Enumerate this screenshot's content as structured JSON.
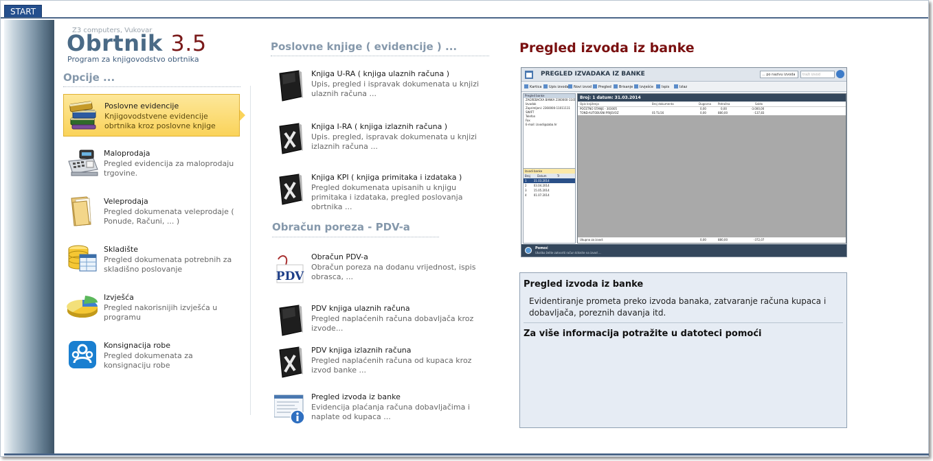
{
  "topbar": {
    "start_label": "START"
  },
  "brand": {
    "company": "Z3 computers, Vukovar",
    "name": "Obrtnik",
    "version": "3.5",
    "subtitle": "Program za knjigovodstvo obrtnika"
  },
  "options": {
    "title": "Opcije ...",
    "items": [
      {
        "title": "Poslovne evidencije",
        "desc": "Knjigovodstvene evidencije obrtnika kroz poslovne knjige",
        "icon": "books-icon",
        "active": true
      },
      {
        "title": "Maloprodaja",
        "desc": "Pregled evidencija za maloprodaju trgovine.",
        "icon": "cash-register-icon",
        "active": false
      },
      {
        "title": "Veleprodaja",
        "desc": "Pregled dokumenata veleprodaje ( Ponude, Računi, ... )",
        "icon": "folder-icon",
        "active": false
      },
      {
        "title": "Skladište",
        "desc": "Pregled dokumenata potrebnih za skladišno poslovanje",
        "icon": "database-table-icon",
        "active": false
      },
      {
        "title": "Izvješća",
        "desc": "Pregled nakorisnijih izvješća u programu",
        "icon": "pie-chart-icon",
        "active": false
      },
      {
        "title": "Konsignacija robe",
        "desc": "Pregled dokumenata za konsignaciju robe",
        "icon": "users-group-icon",
        "active": false
      }
    ]
  },
  "books": {
    "title": "Poslovne knjige ( evidencije ) ...",
    "items": [
      {
        "title": "Knjiga U-RA ( knjiga ulaznih računa )",
        "desc": "Upis, pregled i ispravak dokumenata u knjizi ulaznih računa ...",
        "icon": "black-book-icon"
      },
      {
        "title": "Knjiga I-RA ( knjiga izlaznih računa )",
        "desc": "Upis. pregled, ispravak dokumenata u knjizi izlaznih računa ...",
        "icon": "black-book-x-icon"
      },
      {
        "title": "Knjiga KPI ( knjiga primitaka i izdataka )",
        "desc": "Pregled dokumenata upisanih u knjigu primitaka i izdataka, pregled poslovanja obrtnika ...",
        "icon": "black-book-x-icon"
      }
    ]
  },
  "tax": {
    "title": "Obračun poreza - PDV-a",
    "items": [
      {
        "title": "Obračun PDV-a",
        "desc": "Obračun poreza na dodanu vrijednost, ispis obrasca, ...",
        "icon": "pdv-icon",
        "icon_text": "PDV"
      },
      {
        "title": "PDV knjiga ulaznih računa",
        "desc": "Pregled naplaćenih računa dobavljača kroz izvode...",
        "icon": "black-book-icon"
      },
      {
        "title": "PDV knjiga izlaznih računa",
        "desc": "Pregled naplaćenih računa od kupaca kroz izvod banke ...",
        "icon": "black-book-x-icon"
      },
      {
        "title": "Pregled izvoda iz banke",
        "desc": "Evidencija plaćanja računa dobavljačima i naplate od kupaca ...",
        "icon": "statement-info-icon"
      }
    ]
  },
  "detail": {
    "heading": "Pregled izvoda iz banke",
    "preview": {
      "title": "PREGLED IZVADAKA IZ BANKE",
      "combo": "... po nazivu izvoda",
      "search_placeholder": "traži izvod",
      "toolbar": [
        "Kartica",
        "Upis izvoda",
        "Novi izvod",
        "Pregled",
        "Brisanje",
        "Izvješće",
        "Ispis",
        "Izlaz"
      ],
      "tree_head": "Pregled banke",
      "tree": [
        "ZAGREBAČKA BANKA 2360000-1101...",
        "Izvadak",
        "Zaprimljeni: 2360000-11011111",
        "SWIFT",
        "Telefon",
        "Fax",
        "E-mail: izvodi@zaba.hr"
      ],
      "list_head": "Izvodi banke",
      "list_cols": [
        "Broj",
        "Datum",
        "Tr"
      ],
      "list_rows": [
        {
          "broj": "1",
          "datum": "31.03.2014",
          "selected": true
        },
        {
          "broj": "2",
          "datum": "03.04.2014",
          "selected": false
        },
        {
          "broj": "3",
          "datum": "15.05.2014",
          "selected": false
        },
        {
          "broj": "4",
          "datum": "01.07.2014",
          "selected": false
        }
      ],
      "main_title": "Broj: 1  datum: 31.03.2014",
      "grid_cols": [
        "Opis knjiženja",
        "Broj dokumenta",
        "Dugovna",
        "Potražna",
        "Saldo"
      ],
      "grid_rows": [
        {
          "opis": "POČETNO STANJE - 303005",
          "dok": "",
          "dug": "0,00",
          "pot": "0,00",
          "saldo": "-3.000,00"
        },
        {
          "opis": "TOND-AUTOBUSNI PRIJEVOZ",
          "dok": "01-TL/16",
          "dug": "0,00",
          "pot": "880,00",
          "saldo": "-137,83"
        }
      ],
      "total_label": "Ukupno za izvod:",
      "total_dug": "0,00",
      "total_pot": "880,00",
      "total_saldo": "-372,07",
      "footer_title": "Pomoć",
      "footer_text": "Ukoliko želite zatvoriti račun kliknite na izvod ..."
    },
    "info_title": "Pregled izvoda iz banke",
    "info_desc": "Evidentiranje prometa preko izvoda banaka, zatvaranje računa kupaca i dobavljača, poreznih davanja itd.",
    "info_more": "Za više informacija potražite u datoteci pomoći"
  }
}
